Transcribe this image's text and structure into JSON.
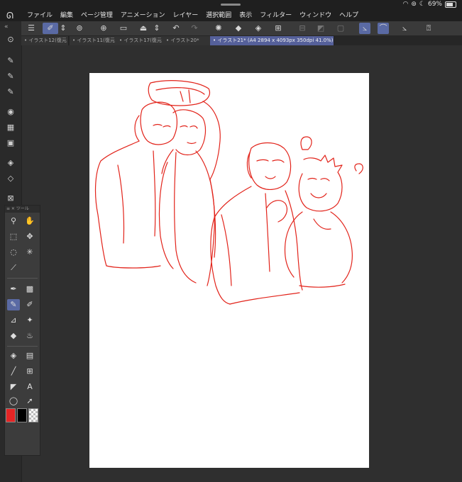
{
  "status": {
    "battery_text": "69%"
  },
  "menu": {
    "items": [
      "ファイル",
      "編集",
      "ページ管理",
      "アニメーション",
      "レイヤー",
      "選択範囲",
      "表示",
      "フィルター",
      "ウィンドウ",
      "ヘルプ"
    ]
  },
  "tabs": [
    {
      "label": "• イラスト12(復元"
    },
    {
      "label": "• イラスト11(復元"
    },
    {
      "label": "• イラスト17(復元"
    },
    {
      "label": "• イラスト20*"
    },
    {
      "label": "• イラスト21* (A4 2894 x 4093px 350dpi 41.0%)"
    }
  ],
  "toolpanel": {
    "title": "ツール"
  },
  "colors": {
    "accent": "#5a6aa4",
    "main_color": "#e52525",
    "sub_color": "#000000",
    "sketch_stroke": "#e2231a"
  },
  "icons": {
    "menu": "hamburger-icon",
    "undo": "undo-icon",
    "redo": "redo-icon",
    "zoom": "zoom-icon",
    "hand": "hand-icon",
    "pen": "pen-icon",
    "text": "text-icon"
  }
}
